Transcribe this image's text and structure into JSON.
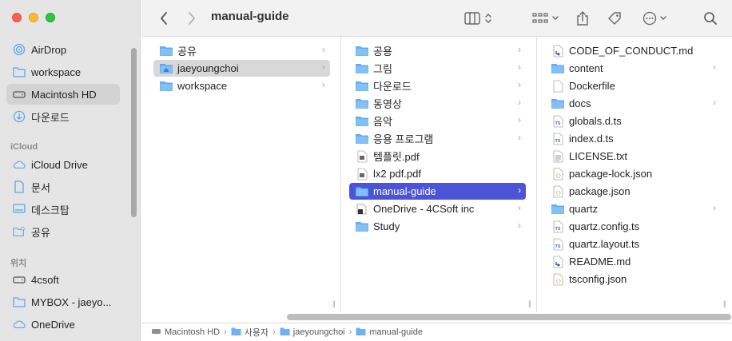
{
  "window": {
    "title": "manual-guide"
  },
  "colors": {
    "selection": "#4b53d7",
    "folder": "#5ba4f0",
    "sidebar_bg": "#e6e5e5"
  },
  "sidebar": {
    "favorites": [
      {
        "label": "AirDrop",
        "icon": "airdrop-icon"
      },
      {
        "label": "workspace",
        "icon": "folder-icon"
      },
      {
        "label": "Macintosh HD",
        "icon": "drive-icon",
        "selected": true
      },
      {
        "label": "다운로드",
        "icon": "download-icon"
      }
    ],
    "icloud_header": "iCloud",
    "icloud": [
      {
        "label": "iCloud Drive",
        "icon": "cloud-icon"
      },
      {
        "label": "문서",
        "icon": "document-icon"
      },
      {
        "label": "데스크탑",
        "icon": "desktop-icon"
      },
      {
        "label": "공유",
        "icon": "shared-folder-icon"
      }
    ],
    "locations_header": "위치",
    "locations": [
      {
        "label": "4csoft",
        "icon": "drive-icon"
      },
      {
        "label": "MYBOX - jaeyo...",
        "icon": "folder-icon"
      },
      {
        "label": "OneDrive",
        "icon": "cloud-icon"
      }
    ]
  },
  "columns": [
    {
      "items": [
        {
          "label": "공유",
          "type": "folder",
          "chevron": true
        },
        {
          "label": "jaeyoungchoi",
          "type": "home",
          "chevron": true,
          "state": "gray"
        },
        {
          "label": "workspace",
          "type": "folder",
          "chevron": true
        }
      ]
    },
    {
      "items": [
        {
          "label": "공용",
          "type": "folder",
          "chevron": true
        },
        {
          "label": "그림",
          "type": "folder",
          "chevron": true
        },
        {
          "label": "다운로드",
          "type": "folder",
          "chevron": true
        },
        {
          "label": "동영상",
          "type": "folder",
          "chevron": true
        },
        {
          "label": "음악",
          "type": "folder",
          "chevron": true
        },
        {
          "label": "응용 프로그램",
          "type": "folder",
          "chevron": true
        },
        {
          "label": "템플릿.pdf",
          "type": "pdf",
          "chevron": false
        },
        {
          "label": "lx2 pdf.pdf",
          "type": "pdf",
          "chevron": false
        },
        {
          "label": "manual-guide",
          "type": "folder",
          "chevron": true,
          "state": "sel"
        },
        {
          "label": "OneDrive - 4CSoft inc",
          "type": "onedrive",
          "chevron": true
        },
        {
          "label": "Study",
          "type": "folder",
          "chevron": true
        }
      ]
    },
    {
      "items": [
        {
          "label": "CODE_OF_CONDUCT.md",
          "type": "md",
          "chevron": false
        },
        {
          "label": "content",
          "type": "folder",
          "chevron": true
        },
        {
          "label": "Dockerfile",
          "type": "file",
          "chevron": false
        },
        {
          "label": "docs",
          "type": "folder",
          "chevron": true
        },
        {
          "label": "globals.d.ts",
          "type": "ts",
          "chevron": false
        },
        {
          "label": "index.d.ts",
          "type": "ts",
          "chevron": false
        },
        {
          "label": "LICENSE.txt",
          "type": "txt",
          "chevron": false
        },
        {
          "label": "package-lock.json",
          "type": "json",
          "chevron": false
        },
        {
          "label": "package.json",
          "type": "json",
          "chevron": false
        },
        {
          "label": "quartz",
          "type": "folder",
          "chevron": true
        },
        {
          "label": "quartz.config.ts",
          "type": "ts",
          "chevron": false
        },
        {
          "label": "quartz.layout.ts",
          "type": "ts",
          "chevron": false
        },
        {
          "label": "README.md",
          "type": "md",
          "chevron": false
        },
        {
          "label": "tsconfig.json",
          "type": "json",
          "chevron": false
        }
      ]
    }
  ],
  "pathbar": [
    "Macintosh HD",
    "사용자",
    "jaeyoungchoi",
    "manual-guide"
  ]
}
